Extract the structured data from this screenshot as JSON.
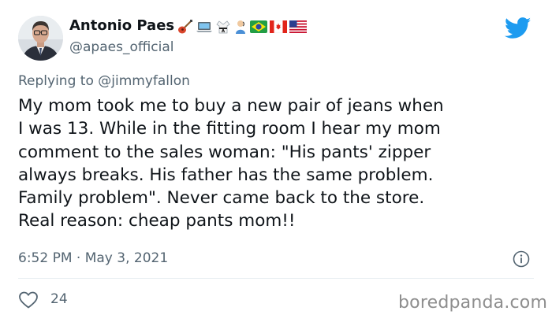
{
  "tweet": {
    "author": {
      "display_name": "Antonio Paes",
      "handle": "@apaes_official",
      "name_emojis": [
        "guitar-emoji",
        "laptop-emoji",
        "martial-arts-uniform-emoji",
        "deaf-person-emoji",
        "brazil-flag",
        "canada-flag",
        "usa-flag"
      ]
    },
    "reply_prefix": "Replying to",
    "reply_to": "@jimmyfallon",
    "text_lines": [
      "My mom took me to buy a new pair of jeans when",
      "I was 13. While in the fitting room I hear my mom",
      "comment to the sales woman: \"His pants' zipper",
      "always breaks. His father has the same problem.",
      "Family problem\". Never came back to the store.",
      "Real reason: cheap pants mom!!"
    ],
    "timestamp": "6:52 PM · May 3, 2021",
    "likes": "24"
  },
  "watermark": "boredpanda.com",
  "colors": {
    "twitter_blue": "#1d9bf0",
    "secondary_text": "#536471",
    "primary_text": "#0f1419"
  },
  "icons": {
    "brand": "twitter-bird-icon",
    "info": "info-icon",
    "like": "heart-outline-icon"
  }
}
